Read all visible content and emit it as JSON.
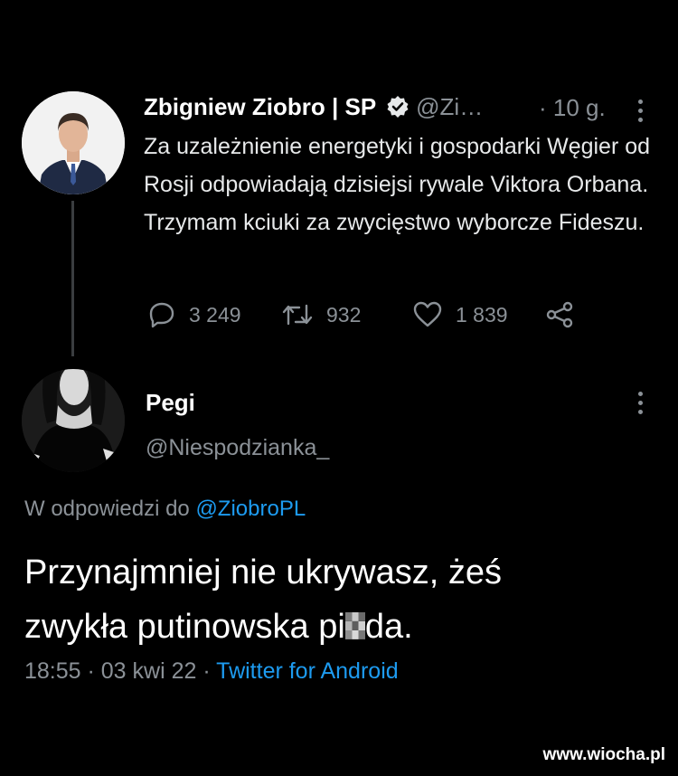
{
  "tweet": {
    "author_name": "Zbigniew Ziobro | SP",
    "handle": "@Zi…",
    "time": "· 10 g.",
    "text": "Za uzależnienie energetyki i gospodarki Węgier od Rosji odpowiadają dzisiejsi rywale Viktora Orbana. Trzymam kciuki za zwycięstwo wyborcze Fideszu.",
    "replies": "3 249",
    "retweets": "932",
    "likes": "1 839"
  },
  "reply": {
    "author_name": "Pegi",
    "handle": "@Niespodzianka_",
    "replying_prefix": "W odpowiedzi do ",
    "replying_to": "@ZiobroPL",
    "text_line1": "Przynajmniej nie ukrywasz, żeś",
    "text_line2_a": "zwykła putinowska pi",
    "text_line2_b": "da.",
    "timestamp": "18:55 · 03 kwi 22 · ",
    "client": "Twitter for Android"
  },
  "watermark": "www.wiocha.pl",
  "colors": {
    "background": "#000000",
    "text": "#e7e9ea",
    "secondary": "#8b9197",
    "link": "#1d9bf0"
  }
}
